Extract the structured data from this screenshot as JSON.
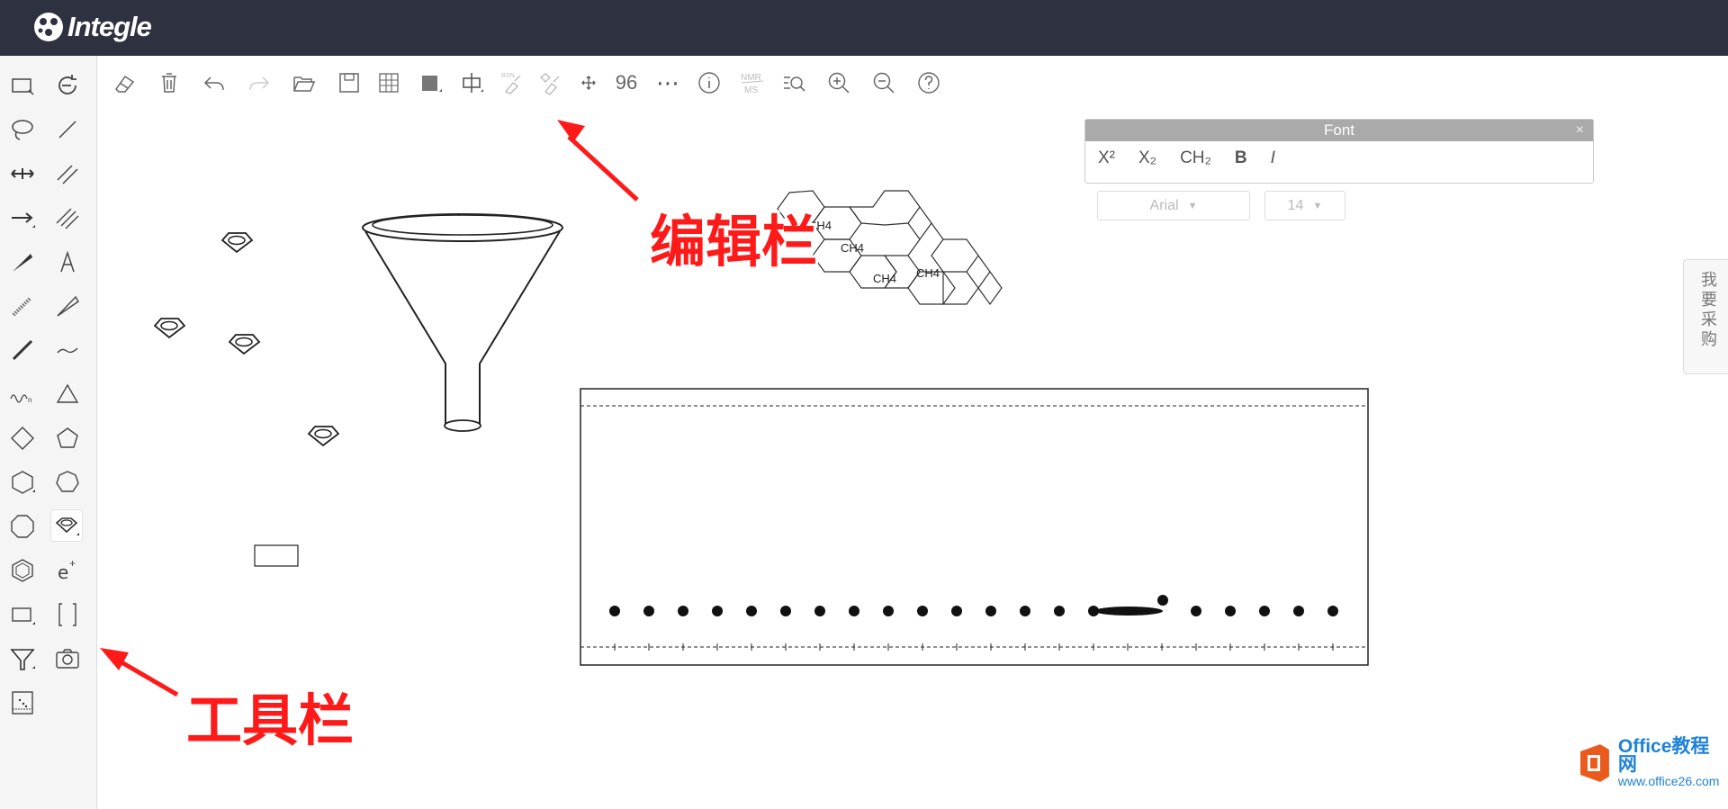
{
  "app": {
    "title": "Integle"
  },
  "font_panel": {
    "title": "Font",
    "close": "×",
    "buttons": [
      "X²",
      "X₂",
      "CH₂",
      "B",
      "I"
    ],
    "font_family": "Arial",
    "font_size": "14"
  },
  "editbar": {
    "shape_count": "96",
    "more": "⋯",
    "rxn_label": "RXN",
    "nmr_label": "NMR",
    "ms_label": "MS"
  },
  "canvas": {
    "ch4_labels": [
      "CH4",
      "CH4",
      "CH4",
      "CH4"
    ]
  },
  "side_tab": {
    "label": "我要采购"
  },
  "annotations": {
    "editbar_label": "编辑栏",
    "toolbar_label": "工具栏"
  },
  "watermark": {
    "brand": "Office教程网",
    "url": "www.office26.com"
  },
  "colors": {
    "topbar": "#2d3140",
    "annotation": "#ff1a1a",
    "panel_header": "#aaaaaa"
  }
}
